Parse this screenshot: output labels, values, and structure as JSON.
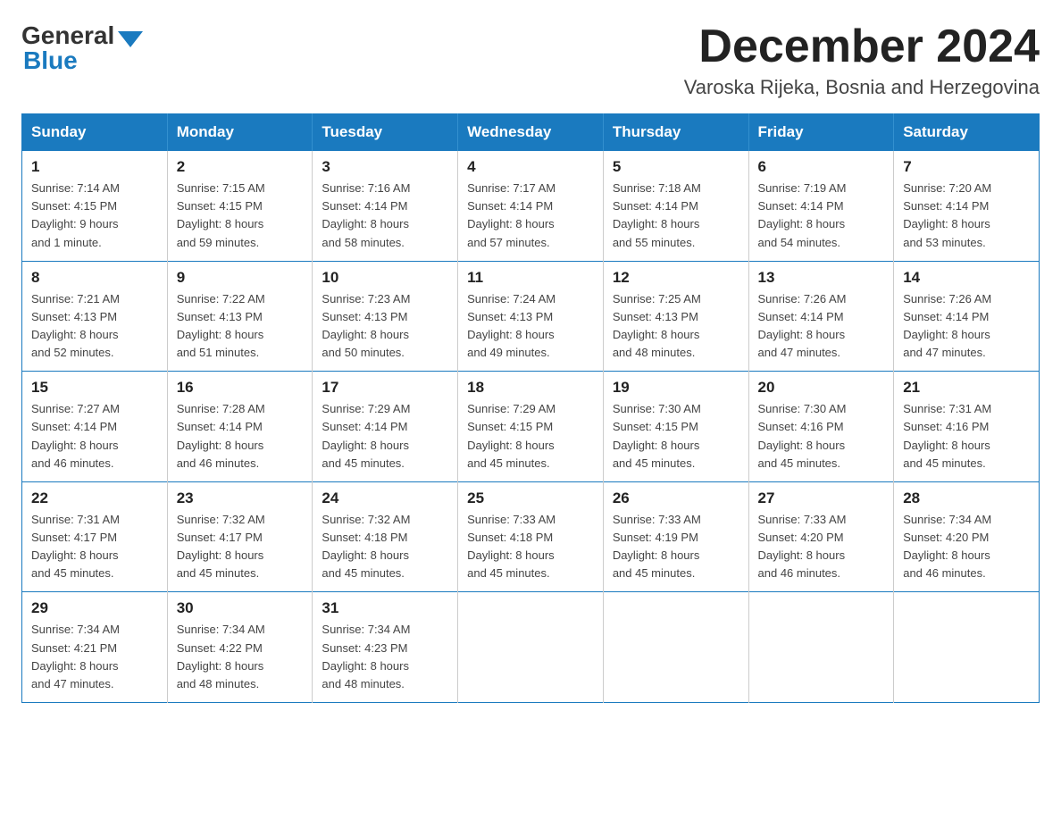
{
  "logo": {
    "general": "General",
    "blue": "Blue"
  },
  "header": {
    "month": "December 2024",
    "location": "Varoska Rijeka, Bosnia and Herzegovina"
  },
  "weekdays": [
    "Sunday",
    "Monday",
    "Tuesday",
    "Wednesday",
    "Thursday",
    "Friday",
    "Saturday"
  ],
  "weeks": [
    [
      {
        "day": "1",
        "sunrise": "7:14 AM",
        "sunset": "4:15 PM",
        "daylight": "9 hours and 1 minute."
      },
      {
        "day": "2",
        "sunrise": "7:15 AM",
        "sunset": "4:15 PM",
        "daylight": "8 hours and 59 minutes."
      },
      {
        "day": "3",
        "sunrise": "7:16 AM",
        "sunset": "4:14 PM",
        "daylight": "8 hours and 58 minutes."
      },
      {
        "day": "4",
        "sunrise": "7:17 AM",
        "sunset": "4:14 PM",
        "daylight": "8 hours and 57 minutes."
      },
      {
        "day": "5",
        "sunrise": "7:18 AM",
        "sunset": "4:14 PM",
        "daylight": "8 hours and 55 minutes."
      },
      {
        "day": "6",
        "sunrise": "7:19 AM",
        "sunset": "4:14 PM",
        "daylight": "8 hours and 54 minutes."
      },
      {
        "day": "7",
        "sunrise": "7:20 AM",
        "sunset": "4:14 PM",
        "daylight": "8 hours and 53 minutes."
      }
    ],
    [
      {
        "day": "8",
        "sunrise": "7:21 AM",
        "sunset": "4:13 PM",
        "daylight": "8 hours and 52 minutes."
      },
      {
        "day": "9",
        "sunrise": "7:22 AM",
        "sunset": "4:13 PM",
        "daylight": "8 hours and 51 minutes."
      },
      {
        "day": "10",
        "sunrise": "7:23 AM",
        "sunset": "4:13 PM",
        "daylight": "8 hours and 50 minutes."
      },
      {
        "day": "11",
        "sunrise": "7:24 AM",
        "sunset": "4:13 PM",
        "daylight": "8 hours and 49 minutes."
      },
      {
        "day": "12",
        "sunrise": "7:25 AM",
        "sunset": "4:13 PM",
        "daylight": "8 hours and 48 minutes."
      },
      {
        "day": "13",
        "sunrise": "7:26 AM",
        "sunset": "4:14 PM",
        "daylight": "8 hours and 47 minutes."
      },
      {
        "day": "14",
        "sunrise": "7:26 AM",
        "sunset": "4:14 PM",
        "daylight": "8 hours and 47 minutes."
      }
    ],
    [
      {
        "day": "15",
        "sunrise": "7:27 AM",
        "sunset": "4:14 PM",
        "daylight": "8 hours and 46 minutes."
      },
      {
        "day": "16",
        "sunrise": "7:28 AM",
        "sunset": "4:14 PM",
        "daylight": "8 hours and 46 minutes."
      },
      {
        "day": "17",
        "sunrise": "7:29 AM",
        "sunset": "4:14 PM",
        "daylight": "8 hours and 45 minutes."
      },
      {
        "day": "18",
        "sunrise": "7:29 AM",
        "sunset": "4:15 PM",
        "daylight": "8 hours and 45 minutes."
      },
      {
        "day": "19",
        "sunrise": "7:30 AM",
        "sunset": "4:15 PM",
        "daylight": "8 hours and 45 minutes."
      },
      {
        "day": "20",
        "sunrise": "7:30 AM",
        "sunset": "4:16 PM",
        "daylight": "8 hours and 45 minutes."
      },
      {
        "day": "21",
        "sunrise": "7:31 AM",
        "sunset": "4:16 PM",
        "daylight": "8 hours and 45 minutes."
      }
    ],
    [
      {
        "day": "22",
        "sunrise": "7:31 AM",
        "sunset": "4:17 PM",
        "daylight": "8 hours and 45 minutes."
      },
      {
        "day": "23",
        "sunrise": "7:32 AM",
        "sunset": "4:17 PM",
        "daylight": "8 hours and 45 minutes."
      },
      {
        "day": "24",
        "sunrise": "7:32 AM",
        "sunset": "4:18 PM",
        "daylight": "8 hours and 45 minutes."
      },
      {
        "day": "25",
        "sunrise": "7:33 AM",
        "sunset": "4:18 PM",
        "daylight": "8 hours and 45 minutes."
      },
      {
        "day": "26",
        "sunrise": "7:33 AM",
        "sunset": "4:19 PM",
        "daylight": "8 hours and 45 minutes."
      },
      {
        "day": "27",
        "sunrise": "7:33 AM",
        "sunset": "4:20 PM",
        "daylight": "8 hours and 46 minutes."
      },
      {
        "day": "28",
        "sunrise": "7:34 AM",
        "sunset": "4:20 PM",
        "daylight": "8 hours and 46 minutes."
      }
    ],
    [
      {
        "day": "29",
        "sunrise": "7:34 AM",
        "sunset": "4:21 PM",
        "daylight": "8 hours and 47 minutes."
      },
      {
        "day": "30",
        "sunrise": "7:34 AM",
        "sunset": "4:22 PM",
        "daylight": "8 hours and 48 minutes."
      },
      {
        "day": "31",
        "sunrise": "7:34 AM",
        "sunset": "4:23 PM",
        "daylight": "8 hours and 48 minutes."
      },
      null,
      null,
      null,
      null
    ]
  ],
  "labels": {
    "sunrise": "Sunrise:",
    "sunset": "Sunset:",
    "daylight": "Daylight:"
  }
}
